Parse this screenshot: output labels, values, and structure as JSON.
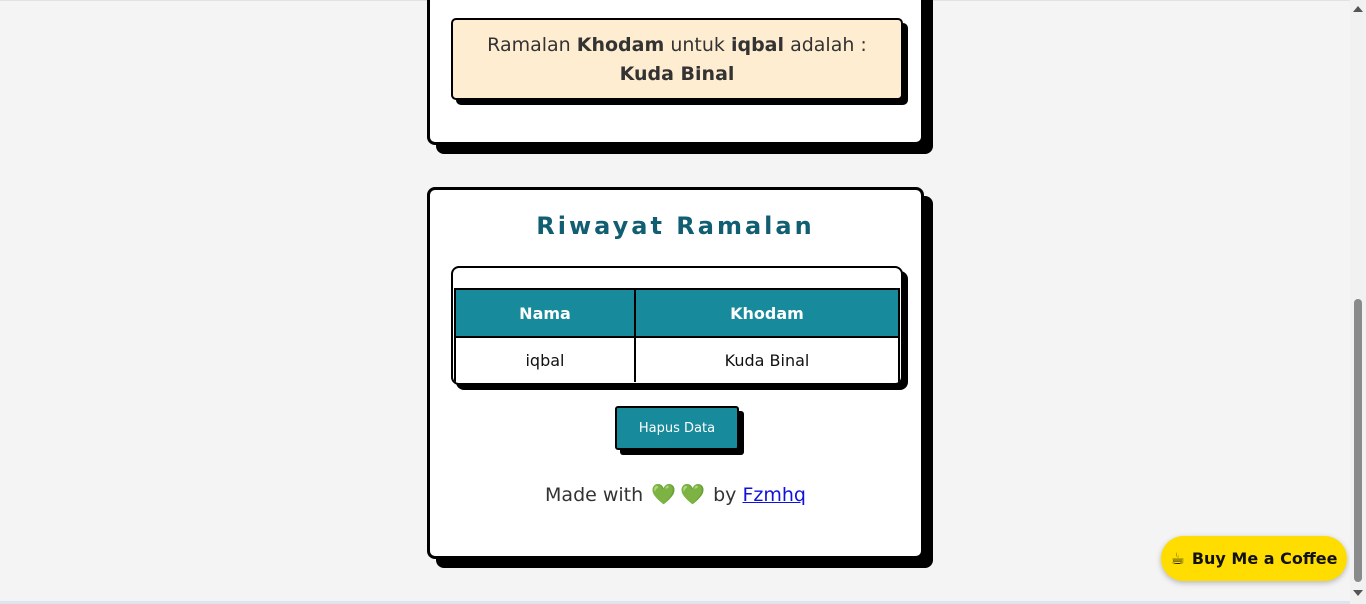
{
  "result": {
    "prefix": "Ramalan",
    "khodam_word": "Khodam",
    "middle": "untuk",
    "name": "iqbal",
    "suffix": "adalah :",
    "khodam_value": "Kuda Binal"
  },
  "history": {
    "title": "Riwayat Ramalan",
    "columns": [
      "Nama",
      "Khodam"
    ],
    "rows": [
      {
        "nama": "iqbal",
        "khodam": "Kuda Binal"
      }
    ],
    "delete_label": "Hapus Data"
  },
  "footer": {
    "made_with": "Made with",
    "hearts": [
      "💚",
      "💚"
    ],
    "by": "by",
    "author_link": "Fzmhq"
  },
  "bmc": {
    "label": "Buy Me a Coffee",
    "icon": "coffee-cup-icon",
    "color": "#ffdd00"
  },
  "colors": {
    "accent": "#178a9b",
    "title": "#115e72",
    "result_bg": "#ffedd1",
    "heart": "#11c05a"
  }
}
